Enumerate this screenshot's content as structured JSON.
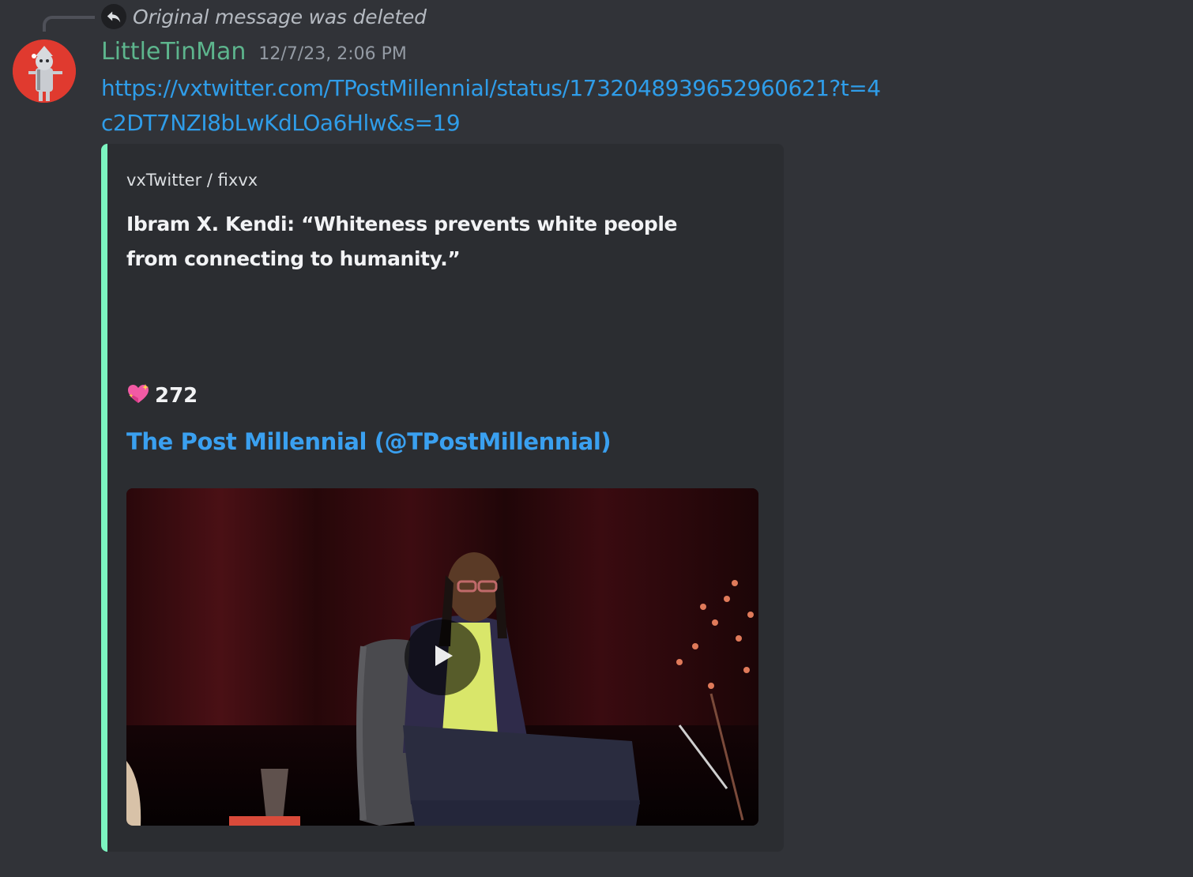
{
  "reply": {
    "text": "Original message was deleted"
  },
  "message": {
    "username": "LittleTinMan",
    "timestamp": "12/7/23, 2:06 PM",
    "link": "https://vxtwitter.com/TPostMillennial/status/1732048939652960621?t=4c2DT7NZI8bLwKdLOa6Hlw&s=19"
  },
  "embed": {
    "provider": "vxTwitter / fixvx",
    "description": "Ibram X. Kendi: “Whiteness prevents white people from connecting to humanity.”",
    "likes_icon": "sparkling-heart-icon",
    "likes_count": "272",
    "author": "The Post Millennial (@TPostMillennial)",
    "accent_color": "#7cf5c0"
  },
  "colors": {
    "background": "#313338",
    "username": "#5db58d",
    "link": "#2f9de9"
  }
}
